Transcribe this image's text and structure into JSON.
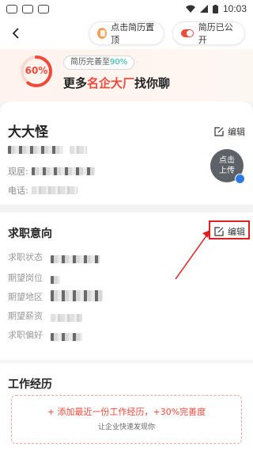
{
  "status_bar": {
    "time": "10:03"
  },
  "header": {
    "pin_label": "点击简历置顶",
    "public_label": "简历已公开"
  },
  "banner": {
    "progress": "60%",
    "progress_value": 0.6,
    "hint_prefix": "简历完善至",
    "hint_pct": "90%",
    "slogan_pre": "更多",
    "slogan_hl": "名企大厂",
    "slogan_post": "找你聊"
  },
  "basic": {
    "name": "大大怪",
    "edit_label": "编辑",
    "residence_label": "现居:",
    "phone_label": "电话:",
    "upload_label_1": "点击",
    "upload_label_2": "上传"
  },
  "intent": {
    "title": "求职意向",
    "edit_label": "编辑",
    "rows": [
      {
        "label": "求职状态"
      },
      {
        "label": "期望岗位"
      },
      {
        "label": "期望地区"
      },
      {
        "label": "期望薪资"
      },
      {
        "label": "求职偏好"
      }
    ]
  },
  "work": {
    "title": "工作经历",
    "add_main": "+ 添加最近一份工作经历，+30%完善度",
    "add_sub": "让企业快速发现你"
  },
  "colors": {
    "accent": "#f04a3b",
    "teal": "#18b6a0",
    "highlight": "#e02020"
  }
}
